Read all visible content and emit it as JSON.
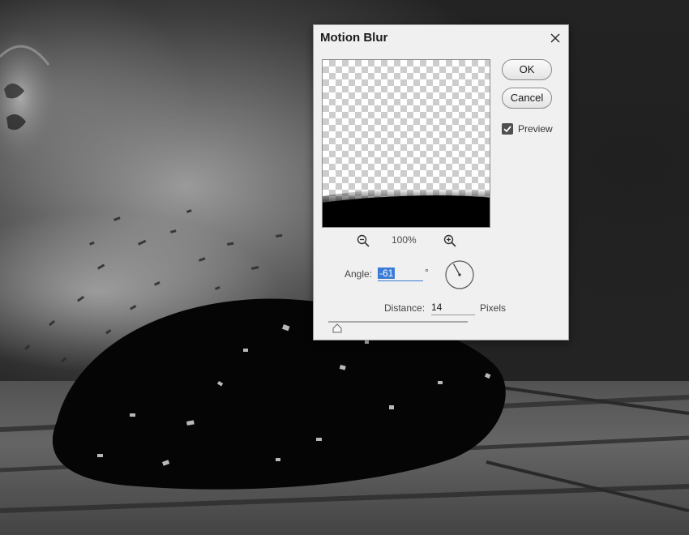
{
  "dialog": {
    "title": "Motion Blur",
    "ok_label": "OK",
    "cancel_label": "Cancel",
    "preview_label": "Preview",
    "preview_checked": true,
    "zoom_level": "100%",
    "angle_label": "Angle:",
    "angle_value": "-61",
    "degree_symbol": "°",
    "distance_label": "Distance:",
    "distance_value": "14",
    "distance_unit": "Pixels",
    "distance_slider_fraction": 0.014,
    "icons": {
      "close": "close-icon",
      "zoom_out": "zoom-out-icon",
      "zoom_in": "zoom-in-icon",
      "checkbox": "checkmark-icon",
      "dial": "angle-dial-icon",
      "slider": "slider-thumb-icon"
    }
  },
  "colors": {
    "dialog_bg": "#f0f0f0",
    "selection": "#3a7bd5",
    "checkbox": "#4f4f4f"
  }
}
